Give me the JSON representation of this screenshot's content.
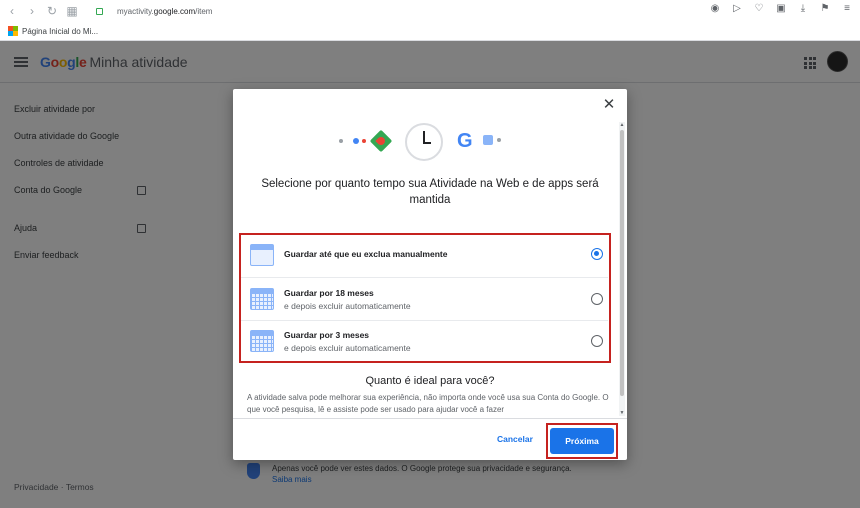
{
  "browser": {
    "url_prefix": "myactivity.",
    "url_domain": "google.com",
    "url_path": "/item",
    "bookmark": "Página Inicial do Mi..."
  },
  "app": {
    "logo": "Google",
    "title": "Minha atividade"
  },
  "sidebar": {
    "items": [
      {
        "label": "Excluir atividade por"
      },
      {
        "label": "Outra atividade do Google"
      },
      {
        "label": "Controles de atividade"
      },
      {
        "label": "Conta do Google"
      },
      {
        "label": "Ajuda"
      },
      {
        "label": "Enviar feedback"
      }
    ],
    "footer": "Privacidade  ·  Termos"
  },
  "background_note": {
    "text": "Apenas você pode ver estes dados. O Google protege sua privacidade e segurança.",
    "link": "Saiba mais"
  },
  "dialog": {
    "title": "Selecione por quanto tempo sua Atividade na Web e de apps será mantida",
    "options": [
      {
        "main": "Guardar até que eu exclua manualmente",
        "sub": "",
        "selected": true
      },
      {
        "main": "Guardar por 18 meses",
        "sub": "e depois excluir automaticamente",
        "selected": false
      },
      {
        "main": "Guardar por 3 meses",
        "sub": "e depois excluir automaticamente",
        "selected": false
      }
    ],
    "ideal_heading": "Quanto é ideal para você?",
    "ideal_text": "A atividade salva pode melhorar sua experiência, não importa onde você usa sua Conta do Google. O que você pesquisa, lê e assiste pode ser usado para ajudar você a fazer",
    "cancel_label": "Cancelar",
    "next_label": "Próxima"
  },
  "colors": {
    "accent": "#1a73e8",
    "highlight_border": "#c5221f"
  }
}
